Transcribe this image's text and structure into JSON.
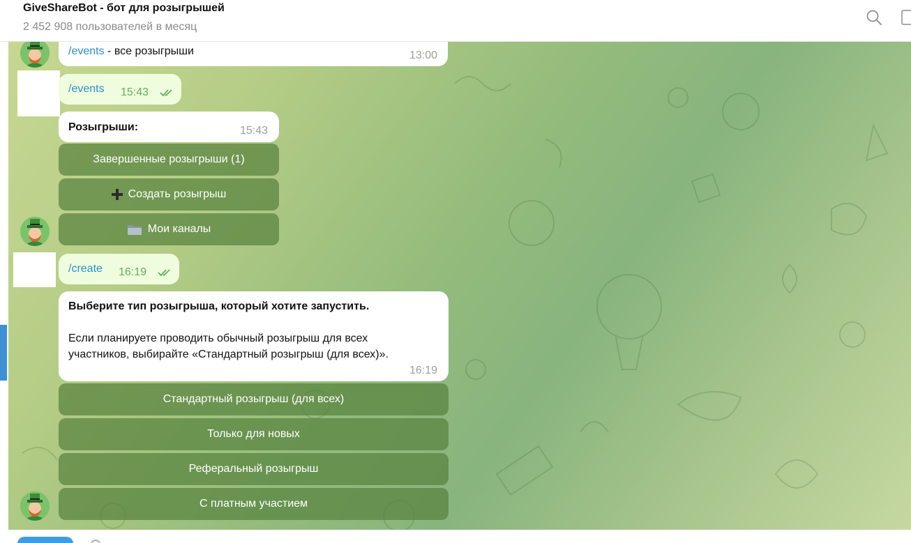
{
  "header": {
    "title": "GiveShareBot - бот для розыгрышей",
    "subtitle": "2 452 908 пользователей в месяц",
    "search_icon": "search-icon",
    "more_icon": "sidebar-toggle-icon"
  },
  "messages": {
    "m1": {
      "command": "/events",
      "text": " - все розыгрыши",
      "time": "13:00"
    },
    "m2": {
      "text": "/events",
      "time": "15:43"
    },
    "m3": {
      "title": "Розыгрыши:",
      "time": "15:43",
      "buttons": [
        {
          "label": "Завершенные розыгрыши (1)",
          "icon": ""
        },
        {
          "label": "Создать розыгрыш",
          "icon": "plus-icon"
        },
        {
          "label": "Мои каналы",
          "icon": "folder-icon"
        }
      ]
    },
    "m4": {
      "text": "/create",
      "time": "16:19"
    },
    "m5": {
      "title": "Выберите тип розыгрыша, который хотите запустить.",
      "body_line1": "Если планируете проводить обычный розыгрыш для всех",
      "body_line2": "участников, выбирайте «Стандартный розыгрыш (для всех)».",
      "time": "16:19",
      "buttons": [
        {
          "label": "Стандартный розыгрыш (для всех)"
        },
        {
          "label": "Только для новых"
        },
        {
          "label": "Реферальный розыгрыш"
        },
        {
          "label": "С платным участием"
        }
      ]
    }
  },
  "colors": {
    "link": "#2b8fd1",
    "outgoing_bubble": "#effdde",
    "keyboard_button": "#58823e",
    "accent": "#3d8fd6"
  }
}
